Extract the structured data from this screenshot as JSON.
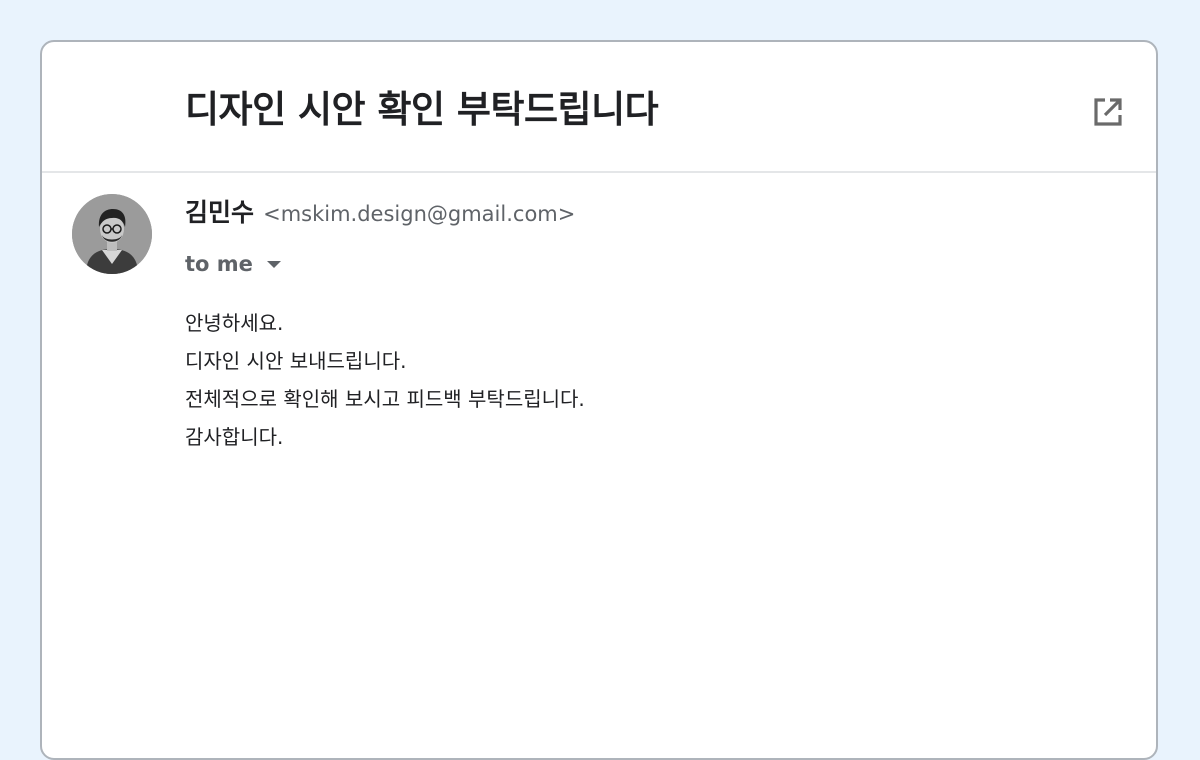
{
  "email": {
    "subject": "디자인 시안 확인 부탁드립니다",
    "popout_icon": "open-in-new-window-icon",
    "sender": {
      "name": "김민수",
      "email": "<mskim.design@gmail.com>",
      "avatar_icon": "person-avatar"
    },
    "recipient": {
      "label": "to me",
      "expand_icon": "caret-down-icon"
    },
    "body_lines": [
      "안녕하세요.",
      "디자인 시안 보내드립니다.",
      "전체적으로 확인해 보시고 피드백 부탁드립니다.",
      "감사합니다."
    ]
  },
  "colors": {
    "page_background": "#e9f3fd",
    "card_border": "#aeb4bb",
    "primary_text": "#202124",
    "secondary_text": "#5f6368"
  }
}
